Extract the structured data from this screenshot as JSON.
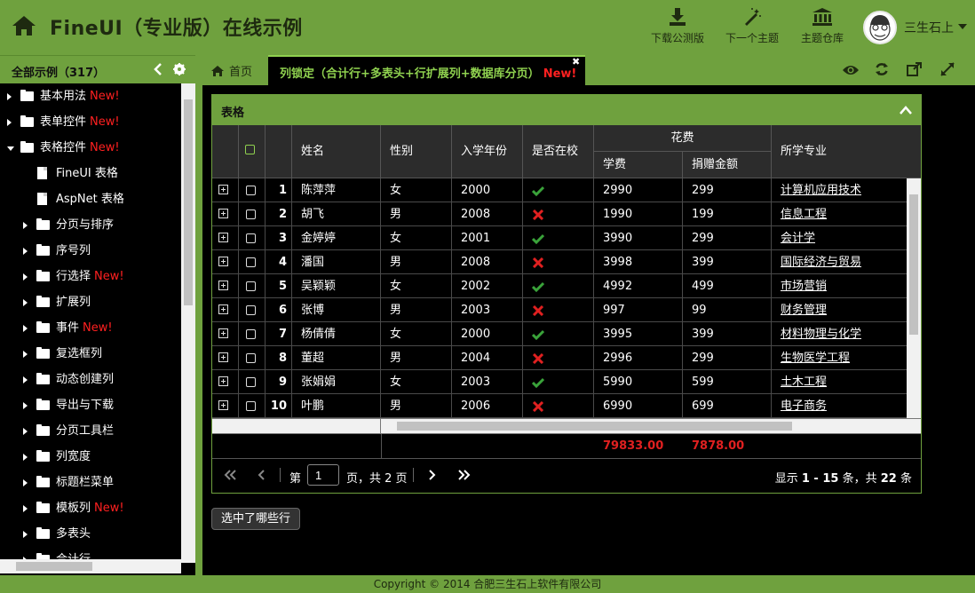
{
  "header": {
    "title": "FineUI（专业版）在线示例",
    "actions": [
      {
        "label": "下载公测版",
        "icon": "download-icon"
      },
      {
        "label": "下一个主题",
        "icon": "magic-wand-icon"
      },
      {
        "label": "主题仓库",
        "icon": "bank-icon"
      }
    ],
    "user_name": "三生石上"
  },
  "sidebar": {
    "title": "全部示例（317）",
    "items": [
      {
        "label": "基本用法",
        "new": "New!",
        "type": "folder",
        "arrow": "right",
        "level": 0
      },
      {
        "label": "表单控件",
        "new": "New!",
        "type": "folder",
        "arrow": "right",
        "level": 0
      },
      {
        "label": "表格控件",
        "new": "New!",
        "type": "folder-open",
        "arrow": "down",
        "level": 0
      },
      {
        "label": "FineUI 表格",
        "new": "",
        "type": "doc",
        "arrow": "",
        "level": 1
      },
      {
        "label": "AspNet 表格",
        "new": "",
        "type": "doc",
        "arrow": "",
        "level": 1
      },
      {
        "label": "分页与排序",
        "new": "",
        "type": "folder",
        "arrow": "right",
        "level": 1
      },
      {
        "label": "序号列",
        "new": "",
        "type": "folder",
        "arrow": "right",
        "level": 1
      },
      {
        "label": "行选择",
        "new": "New!",
        "type": "folder",
        "arrow": "right",
        "level": 1
      },
      {
        "label": "扩展列",
        "new": "",
        "type": "folder",
        "arrow": "right",
        "level": 1
      },
      {
        "label": "事件",
        "new": "New!",
        "type": "folder",
        "arrow": "right",
        "level": 1
      },
      {
        "label": "复选框列",
        "new": "",
        "type": "folder",
        "arrow": "right",
        "level": 1
      },
      {
        "label": "动态创建列",
        "new": "",
        "type": "folder",
        "arrow": "right",
        "level": 1
      },
      {
        "label": "导出与下载",
        "new": "",
        "type": "folder",
        "arrow": "right",
        "level": 1
      },
      {
        "label": "分页工具栏",
        "new": "",
        "type": "folder",
        "arrow": "right",
        "level": 1
      },
      {
        "label": "列宽度",
        "new": "",
        "type": "folder",
        "arrow": "right",
        "level": 1
      },
      {
        "label": "标题栏菜单",
        "new": "",
        "type": "folder",
        "arrow": "right",
        "level": 1
      },
      {
        "label": "模板列",
        "new": "New!",
        "type": "folder",
        "arrow": "right",
        "level": 1
      },
      {
        "label": "多表头",
        "new": "",
        "type": "folder",
        "arrow": "right",
        "level": 1
      },
      {
        "label": "合计行",
        "new": "",
        "type": "folder",
        "arrow": "right",
        "level": 1
      }
    ]
  },
  "tabs": {
    "home": "首页",
    "active": "列锁定（合计行+多表头+行扩展列+数据库分页）",
    "active_new": "New!"
  },
  "panel": {
    "title": "表格",
    "columns": {
      "name": "姓名",
      "gender": "性别",
      "year": "入学年份",
      "atschool": "是否在校",
      "cost_group": "花费",
      "fee": "学费",
      "donate": "捐赠金额",
      "major": "所学专业"
    },
    "rows": [
      {
        "no": "1",
        "name": "陈萍萍",
        "gender": "女",
        "year": "2000",
        "atschool": true,
        "fee": "2990",
        "donate": "299",
        "major": "计算机应用技术"
      },
      {
        "no": "2",
        "name": "胡飞",
        "gender": "男",
        "year": "2008",
        "atschool": false,
        "fee": "1990",
        "donate": "199",
        "major": "信息工程"
      },
      {
        "no": "3",
        "name": "金婷婷",
        "gender": "女",
        "year": "2001",
        "atschool": true,
        "fee": "3990",
        "donate": "299",
        "major": "会计学"
      },
      {
        "no": "4",
        "name": "潘国",
        "gender": "男",
        "year": "2008",
        "atschool": false,
        "fee": "3998",
        "donate": "399",
        "major": "国际经济与贸易"
      },
      {
        "no": "5",
        "name": "吴颖颖",
        "gender": "女",
        "year": "2002",
        "atschool": true,
        "fee": "4992",
        "donate": "499",
        "major": "市场营销"
      },
      {
        "no": "6",
        "name": "张博",
        "gender": "男",
        "year": "2003",
        "atschool": false,
        "fee": "997",
        "donate": "99",
        "major": "财务管理"
      },
      {
        "no": "7",
        "name": "杨倩倩",
        "gender": "女",
        "year": "2000",
        "atschool": true,
        "fee": "3995",
        "donate": "399",
        "major": "材料物理与化学"
      },
      {
        "no": "8",
        "name": "董超",
        "gender": "男",
        "year": "2004",
        "atschool": false,
        "fee": "2996",
        "donate": "299",
        "major": "生物医学工程"
      },
      {
        "no": "9",
        "name": "张娟娟",
        "gender": "女",
        "year": "2003",
        "atschool": true,
        "fee": "5990",
        "donate": "599",
        "major": "土木工程"
      },
      {
        "no": "10",
        "name": "叶鹏",
        "gender": "男",
        "year": "2006",
        "atschool": false,
        "fee": "6990",
        "donate": "699",
        "major": "电子商务"
      }
    ],
    "summary": {
      "fee": "79833.00",
      "donate": "7878.00"
    },
    "pager": {
      "page_label_pre": "第",
      "page_value": "1",
      "page_label_post": "页，共 2 页",
      "display_prefix": "显示",
      "display_range": "1 - 15",
      "display_mid": "条，共",
      "display_total": "22",
      "display_suffix": "条"
    }
  },
  "button_selected": "选中了哪些行",
  "footer": "Copyright © 2014 合肥三生石上软件有限公司",
  "colors": {
    "accent": "#6fa13e",
    "check": "#3aa33a",
    "cross": "#e02020",
    "new": "#ff2020",
    "tab_text": "#8fd14f"
  }
}
